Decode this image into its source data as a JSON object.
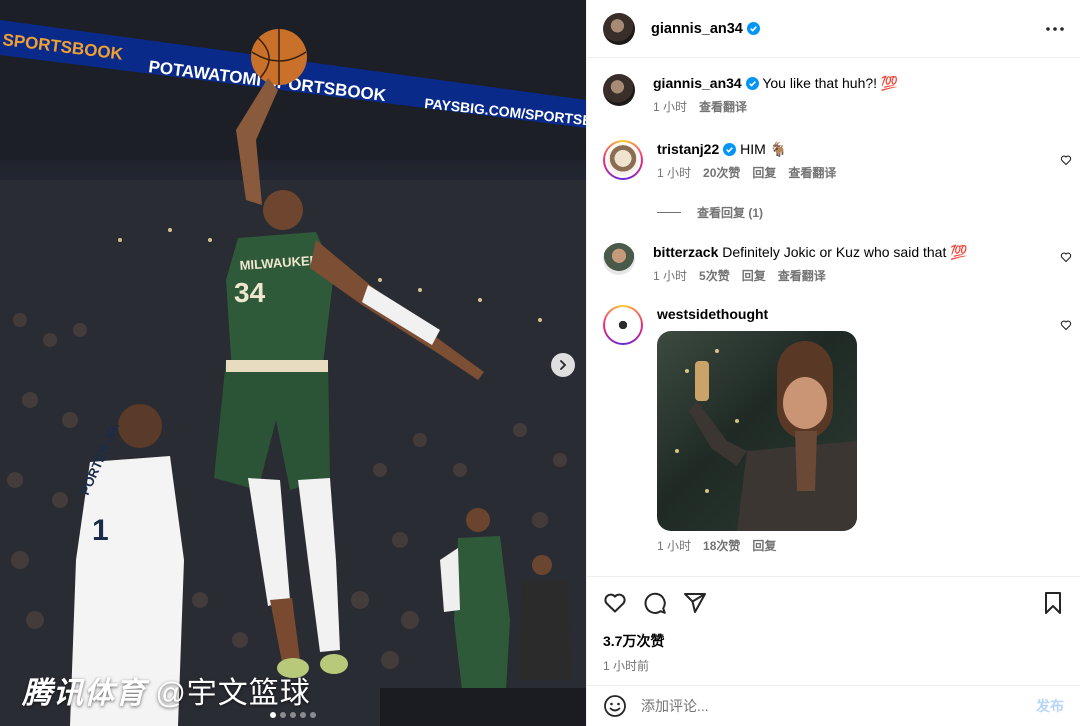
{
  "post": {
    "username": "giannis_an34",
    "caption_username": "giannis_an34",
    "caption": "You like that huh?! 💯",
    "caption_time": "1 小时",
    "caption_translate": "查看翻译",
    "likes": "3.7万次赞",
    "posted": "1 小时前"
  },
  "photo": {
    "watermark_brand": "腾讯体育",
    "watermark_handle": "@宇文篮球",
    "jersey_number_main": "34",
    "jersey_text_main": "MILWAUKEE",
    "jersey_number_opponent": "1",
    "jersey_text_opponent": "PORTER JR.",
    "arena_banner_1": "SPORTSBOOK",
    "arena_banner_2": "POTAWATOMI SPORTSBOOK",
    "arena_banner_3": "PAYSBIG.COM/SPORTSB",
    "slide_count": 5,
    "active_slide": 0
  },
  "comments": [
    {
      "user": "tristanj22",
      "verified": true,
      "text": "HIM 🐐",
      "time": "1 小时",
      "likes": "20次赞",
      "reply": "回复",
      "translate": "查看翻译",
      "view_replies": "查看回复 (1)"
    },
    {
      "user": "bitterzack",
      "verified": false,
      "text": "Definitely Jokic or Kuz who said that 💯",
      "time": "1 小时",
      "likes": "5次赞",
      "reply": "回复",
      "translate": "查看翻译"
    },
    {
      "user": "westsidethought",
      "verified": false,
      "text": "",
      "time": "1 小时",
      "likes": "18次赞",
      "reply": "回复"
    }
  ],
  "composer": {
    "placeholder": "添加评论...",
    "publish": "发布"
  },
  "colors": {
    "verified_blue": "#0095f6",
    "publish_disabled": "#b6d5f9",
    "bucks_green": "#2e5a3a"
  },
  "icons": [
    "more-icon",
    "heart-icon",
    "comment-icon",
    "share-icon",
    "bookmark-icon",
    "emoji-icon",
    "verified-icon",
    "chevron-right-icon"
  ]
}
